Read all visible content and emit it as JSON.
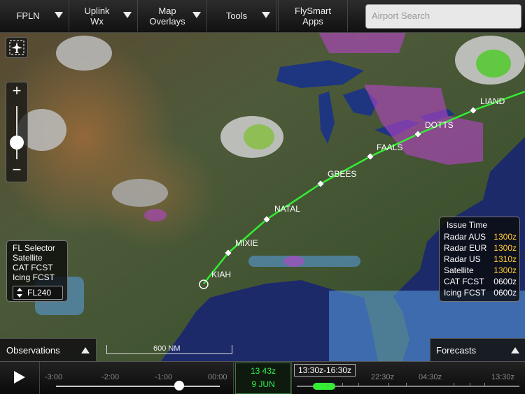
{
  "toolbar": {
    "fpln": "FPLN",
    "uplink_wx": "Uplink\nWx",
    "map_overlays": "Map\nOverlays",
    "tools": "Tools",
    "flysmart_apps": "FlySmart\nApps",
    "search_placeholder": "Airport Search"
  },
  "map": {
    "waypoints": [
      "KIAH",
      "MIXIE",
      "NATAL",
      "GBEES",
      "FAALS",
      "DOTTS",
      "LIAND"
    ],
    "route_color": "#33ee33",
    "scale_label": "600 NM"
  },
  "fl_selector": {
    "title": "FL Selector",
    "layers": [
      "Satellite",
      "CAT FCST",
      "Icing FCST"
    ],
    "value": "FL240"
  },
  "issue_time": {
    "title": "Issue Time",
    "rows": [
      {
        "label": "Radar AUS",
        "time": "1300z",
        "color": "#ffcc33"
      },
      {
        "label": "Radar EUR",
        "time": "1300z",
        "color": "#ffcc33"
      },
      {
        "label": "Radar US",
        "time": "1310z",
        "color": "#ffcc33"
      },
      {
        "label": "Satellite",
        "time": "1300z",
        "color": "#ffcc33"
      },
      {
        "label": "CAT FCST",
        "time": "0600z",
        "color": "#ffffff"
      },
      {
        "label": "Icing FCST",
        "time": "0600z",
        "color": "#ffffff"
      }
    ]
  },
  "bottom": {
    "observations": "Observations",
    "forecasts": "Forecasts"
  },
  "timeline": {
    "past_labels": [
      "-3:00",
      "-2:00",
      "-1:00",
      "00:00"
    ],
    "current_time": "13 43z",
    "current_date": "9 JUN",
    "forecast_range": "13:30z-16:30z",
    "forecast_labels": [
      "22:30z",
      "04:30z",
      "13:30z"
    ]
  }
}
